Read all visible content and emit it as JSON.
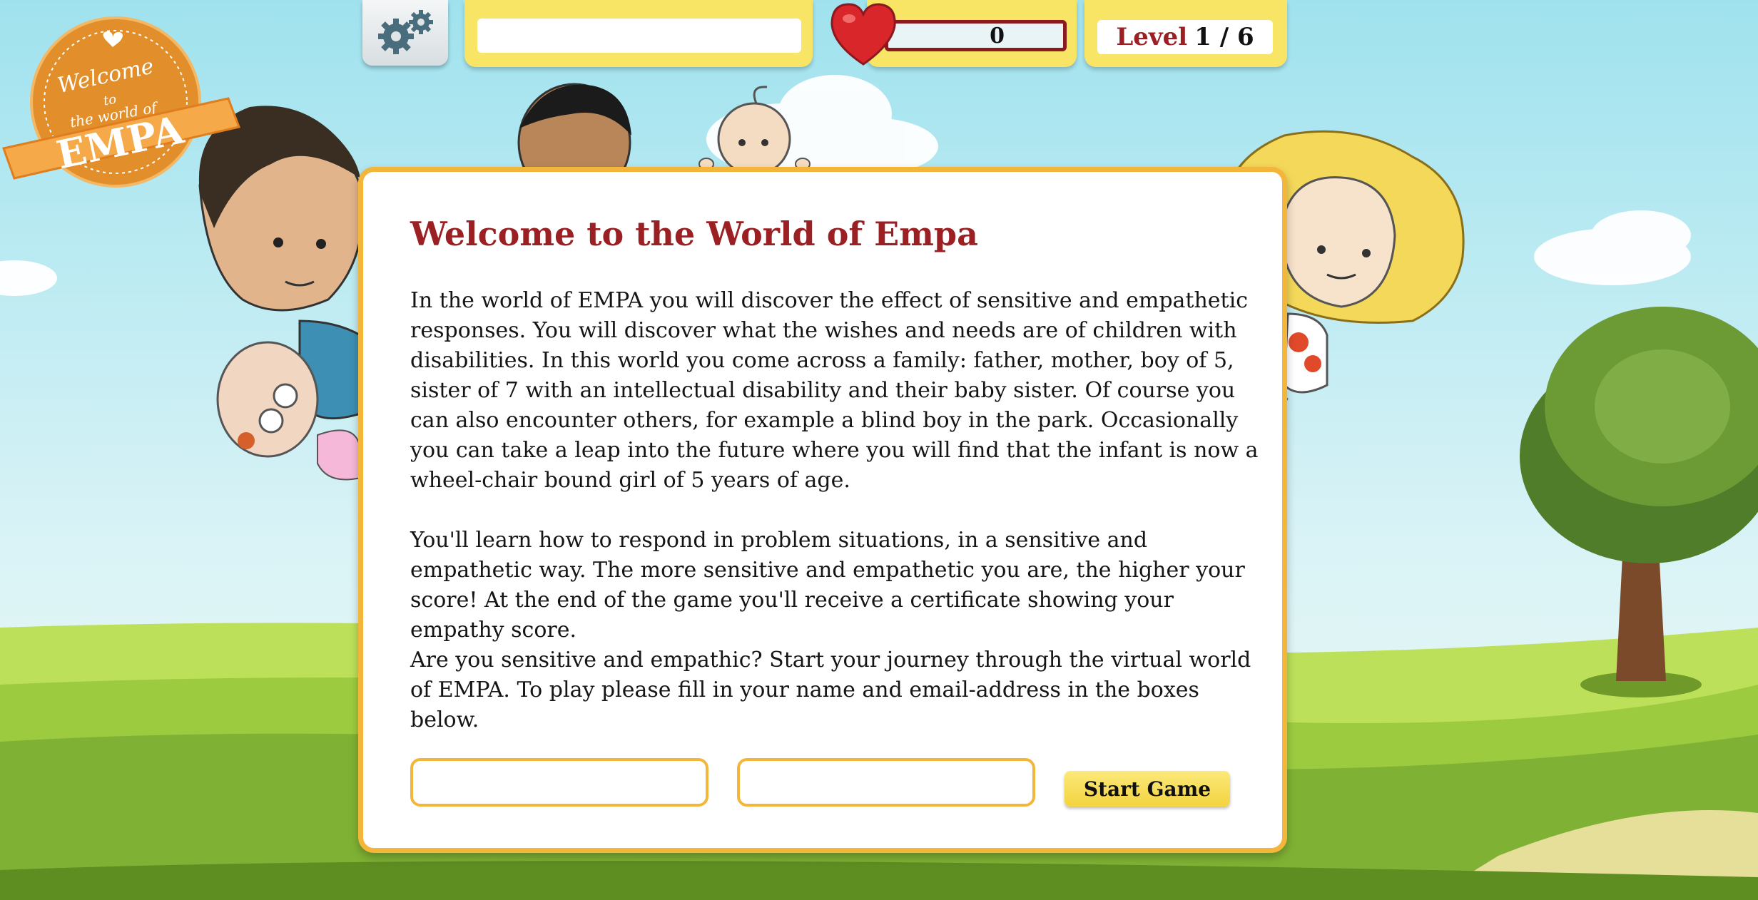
{
  "hud": {
    "score": "0",
    "level_label": "Level",
    "level_value": "1 / 6"
  },
  "badge": {
    "line1": "Welcome",
    "line2": "to",
    "line3": "the world of",
    "line4": "EMPA"
  },
  "dialog": {
    "title": "Welcome to the World of Empa",
    "paragraph1": "In the world of EMPA you will discover the effect of sensitive and empathetic responses. You will discover what the wishes and needs are of children with disabilities. In this world you come across a family: father, mother, boy of 5, sister of 7 with an intellectual disability and their baby sister. Of course you can also encounter others, for example a blind boy in the park. Occasionally you can take a leap into the future where you will find that the infant is now a wheel-chair bound girl of 5 years of age.",
    "paragraph2": "You'll learn how to respond in problem situations, in a sensitive and empathetic way. The more sensitive and empathetic you are, the higher your score! At the end of the game you'll receive a certificate showing your empathy score.",
    "paragraph3": "Are you sensitive and empathic? Start your journey through the virtual world of EMPA. To play please fill in your name and email-address in the boxes below.",
    "name_value": "",
    "email_value": "",
    "start_label": "Start Game"
  },
  "colors": {
    "sky_top": "#a6e4ef",
    "grass": "#8fc23a",
    "accent_red": "#9a2024",
    "accent_yellow": "#f9e565",
    "border_orange": "#f4b63a"
  },
  "icons": {
    "settings": "gear-icon",
    "lives": "heart-icon"
  }
}
